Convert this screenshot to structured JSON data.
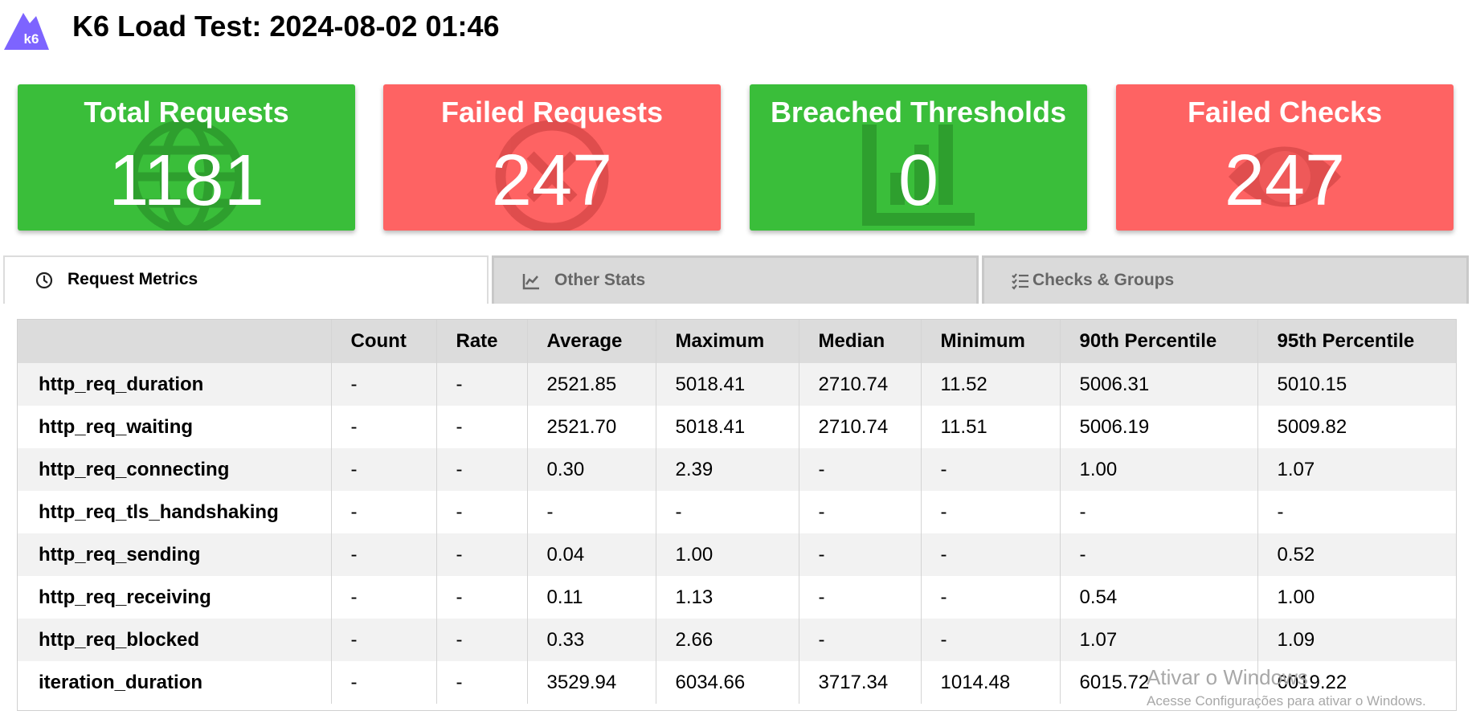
{
  "header": {
    "logo_text": "k6",
    "title": "K6 Load Test: 2024-08-02 01:46"
  },
  "colors": {
    "success": "#3abe3a",
    "failure": "#fe6363",
    "logo": "#7d64ff"
  },
  "cards": [
    {
      "title": "Total Requests",
      "value": "1181",
      "status": "green",
      "icon": "globe-icon"
    },
    {
      "title": "Failed Requests",
      "value": "247",
      "status": "red",
      "icon": "no-entry-icon"
    },
    {
      "title": "Breached Thresholds",
      "value": "0",
      "status": "green",
      "icon": "bar-chart-icon"
    },
    {
      "title": "Failed Checks",
      "value": "247",
      "status": "red",
      "icon": "eye-icon"
    }
  ],
  "tabs": [
    {
      "label": "Request Metrics",
      "icon": "clock-icon",
      "active": true
    },
    {
      "label": "Other Stats",
      "icon": "line-chart-icon",
      "active": false
    },
    {
      "label": "Checks & Groups",
      "icon": "checklist-icon",
      "active": false
    }
  ],
  "table": {
    "columns": [
      "",
      "Count",
      "Rate",
      "Average",
      "Maximum",
      "Median",
      "Minimum",
      "90th Percentile",
      "95th Percentile"
    ],
    "rows": [
      [
        "http_req_duration",
        "-",
        "-",
        "2521.85",
        "5018.41",
        "2710.74",
        "11.52",
        "5006.31",
        "5010.15"
      ],
      [
        "http_req_waiting",
        "-",
        "-",
        "2521.70",
        "5018.41",
        "2710.74",
        "11.51",
        "5006.19",
        "5009.82"
      ],
      [
        "http_req_connecting",
        "-",
        "-",
        "0.30",
        "2.39",
        "-",
        "-",
        "1.00",
        "1.07"
      ],
      [
        "http_req_tls_handshaking",
        "-",
        "-",
        "-",
        "-",
        "-",
        "-",
        "-",
        "-"
      ],
      [
        "http_req_sending",
        "-",
        "-",
        "0.04",
        "1.00",
        "-",
        "-",
        "-",
        "0.52"
      ],
      [
        "http_req_receiving",
        "-",
        "-",
        "0.11",
        "1.13",
        "-",
        "-",
        "0.54",
        "1.00"
      ],
      [
        "http_req_blocked",
        "-",
        "-",
        "0.33",
        "2.66",
        "-",
        "-",
        "1.07",
        "1.09"
      ],
      [
        "iteration_duration",
        "-",
        "-",
        "3529.94",
        "6034.66",
        "3717.34",
        "1014.48",
        "6015.72",
        "6019.22"
      ]
    ]
  },
  "watermark": {
    "line1": "Ativar o Windows",
    "line2": "Acesse Configurações para ativar o Windows."
  }
}
